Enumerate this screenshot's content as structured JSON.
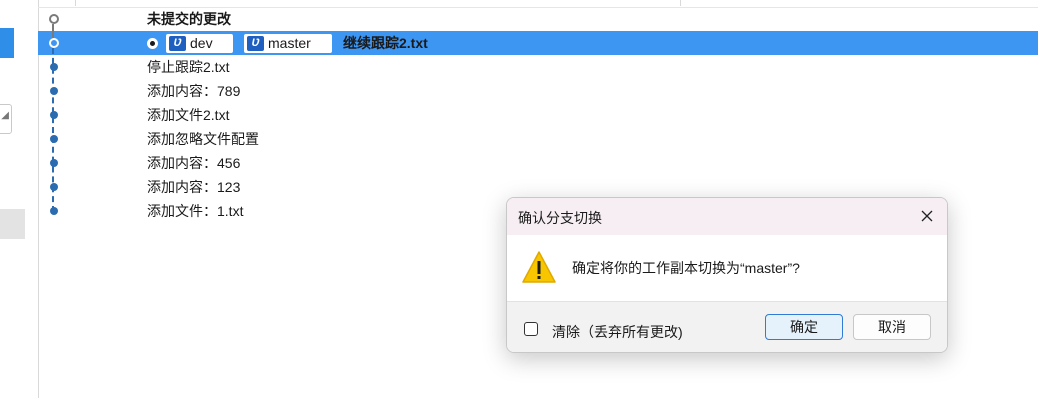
{
  "commits": [
    {
      "message": "未提交的更改"
    },
    {
      "message": "继续跟踪2.txt"
    },
    {
      "message": "停止跟踪2.txt"
    },
    {
      "message": "添加内容：789"
    },
    {
      "message": "添加文件2.txt"
    },
    {
      "message": "添加忽略文件配置"
    },
    {
      "message": "添加内容：456"
    },
    {
      "message": "添加内容：123"
    },
    {
      "message": "添加文件：1.txt"
    }
  ],
  "refs": {
    "branch1": "dev",
    "branch2": "master",
    "branch_icon": "branch-icon"
  },
  "dialog": {
    "title": "确认分支切换",
    "message": "确定将你的工作副本切换为“master”?",
    "checkbox_label": "清除（丢弃所有更改)",
    "checkbox_checked": false,
    "ok_label": "确定",
    "cancel_label": "取消",
    "warning_icon": "warning-icon",
    "close_icon": "close-icon"
  },
  "colors": {
    "selection": "#3d96f2",
    "graph": "#2b6cb0",
    "ref_badge": "#1f5fbf",
    "ok_border": "#2f7bd6"
  }
}
